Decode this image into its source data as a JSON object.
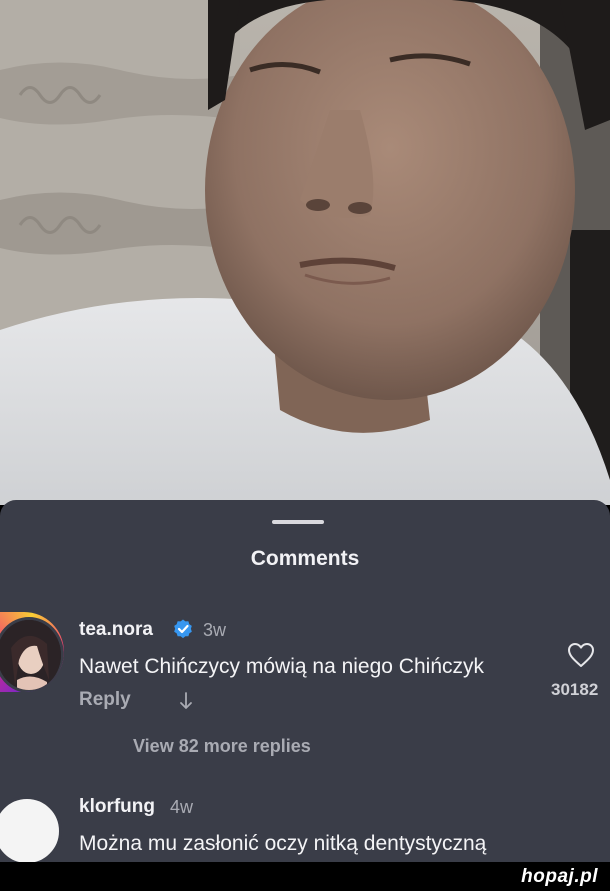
{
  "sheet": {
    "title": "Comments"
  },
  "comments": [
    {
      "username": "tea.nora",
      "verified": true,
      "time": "3w",
      "text": "Nawet Chińczycy mówią na niego Chińczyk",
      "reply_label": "Reply",
      "likes": "30182",
      "more_replies": "View 82 more replies"
    },
    {
      "username": "klorfung",
      "time": "4w",
      "text": "Można mu zasłonić oczy nitką dentystyczną"
    }
  ],
  "watermark": "hopaj.pl",
  "icons": {
    "verified": "verified-badge-icon",
    "like": "heart-outline-icon",
    "translate": "arrow-down-icon"
  },
  "colors": {
    "sheet_bg": "#3a3d48",
    "verified_blue": "#3797f0",
    "muted_text": "#a9abb3"
  }
}
